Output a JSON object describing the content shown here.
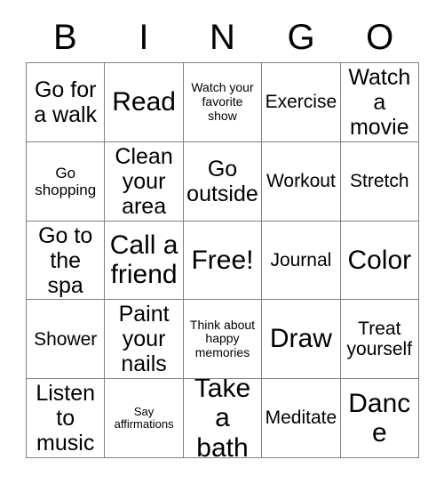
{
  "card": {
    "title_letters": [
      "B",
      "I",
      "N",
      "G",
      "O"
    ],
    "grid": {
      "rows": 5,
      "columns": 5,
      "border_color": "#808080",
      "background_color": "#ffffff",
      "text_color": "#000000"
    },
    "cells": [
      [
        {
          "text": "Go for a walk",
          "size": "fs-lg"
        },
        {
          "text": "Read",
          "size": "fs-xl"
        },
        {
          "text": "Watch your favorite show",
          "size": "fs-xs"
        },
        {
          "text": "Exercise",
          "size": "fs-md"
        },
        {
          "text": "Watch a movie",
          "size": "fs-lg"
        }
      ],
      [
        {
          "text": "Go shopping",
          "size": "fs-sm"
        },
        {
          "text": "Clean your area",
          "size": "fs-lg"
        },
        {
          "text": "Go outside",
          "size": "fs-lg"
        },
        {
          "text": "Workout",
          "size": "fs-md"
        },
        {
          "text": "Stretch",
          "size": "fs-md"
        }
      ],
      [
        {
          "text": "Go to the spa",
          "size": "fs-lg"
        },
        {
          "text": "Call a friend",
          "size": "fs-xl"
        },
        {
          "text": "Free!",
          "size": "fs-xl"
        },
        {
          "text": "Journal",
          "size": "fs-md"
        },
        {
          "text": "Color",
          "size": "fs-xl"
        }
      ],
      [
        {
          "text": "Shower",
          "size": "fs-md"
        },
        {
          "text": "Paint your nails",
          "size": "fs-lg"
        },
        {
          "text": "Think about happy memories",
          "size": "fs-xs"
        },
        {
          "text": "Draw",
          "size": "fs-xl"
        },
        {
          "text": "Treat yourself",
          "size": "fs-md"
        }
      ],
      [
        {
          "text": "Listen to music",
          "size": "fs-lg"
        },
        {
          "text": "Say affirmations",
          "size": "fs-xxs"
        },
        {
          "text": "Take a bath",
          "size": "fs-xl"
        },
        {
          "text": "Meditate",
          "size": "fs-md"
        },
        {
          "text": "Dance",
          "size": "fs-xl"
        }
      ]
    ]
  }
}
